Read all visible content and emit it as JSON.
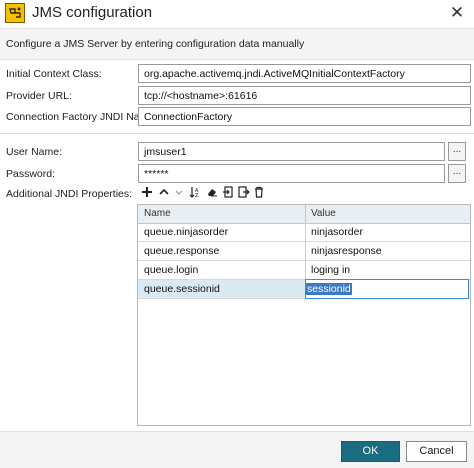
{
  "window": {
    "title": "JMS configuration",
    "close_glyph": "✕"
  },
  "description": "Configure a JMS Server by entering configuration data manually",
  "fields": {
    "initial_context_class": {
      "label": "Initial Context Class:",
      "value": "org.apache.activemq.jndi.ActiveMQInitialContextFactory"
    },
    "provider_url": {
      "label": "Provider URL:",
      "value": "tcp://<hostname>:61616"
    },
    "connection_factory": {
      "label": "Connection Factory JNDI Name:",
      "value": "ConnectionFactory"
    },
    "user_name": {
      "label": "User Name:",
      "value": "jmsuser1",
      "browse": "..."
    },
    "password": {
      "label": "Password:",
      "value": "******",
      "browse": "..."
    }
  },
  "jndi": {
    "label": "Additional JNDI Properties:",
    "toolbar_icons": [
      "add-icon",
      "move-up-icon",
      "move-down-icon",
      "sort-icon",
      "clear-icon",
      "import-icon",
      "export-icon",
      "delete-icon"
    ],
    "columns": {
      "name": "Name",
      "value": "Value"
    },
    "rows": [
      {
        "name": "queue.ninjasorder",
        "value": "ninjasorder"
      },
      {
        "name": "queue.response",
        "value": "ninjasresponse"
      },
      {
        "name": "queue.login",
        "value": "loging in"
      },
      {
        "name": "queue.sessionid",
        "value": "sessionid",
        "selected": true
      }
    ]
  },
  "buttons": {
    "ok": "OK",
    "cancel": "Cancel"
  },
  "colors": {
    "primary_button": "#1a6d80",
    "selection": "#3a78c8",
    "row_selected": "#dbe9f2"
  }
}
